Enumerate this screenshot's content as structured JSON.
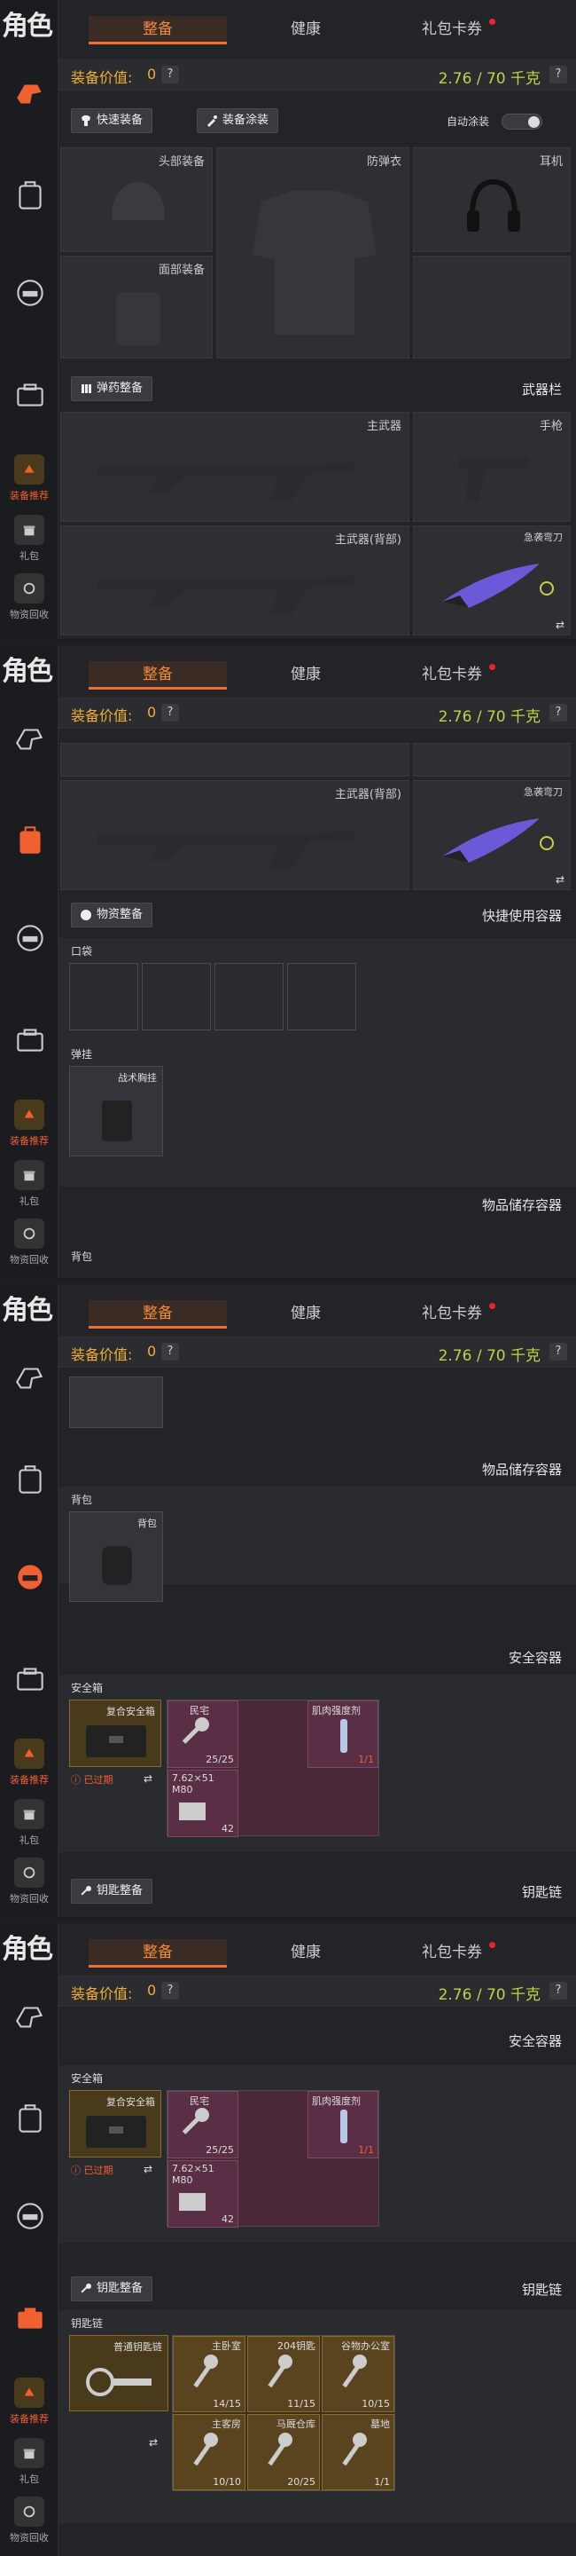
{
  "app": {
    "title": "角色"
  },
  "tabs": [
    {
      "label": "整备"
    },
    {
      "label": "健康"
    },
    {
      "label": "礼包卡券"
    }
  ],
  "sidebar": {
    "items": [
      {
        "label": "装备推荐",
        "color": "#f06030"
      },
      {
        "label": "礼包"
      },
      {
        "label": "物资回收"
      }
    ]
  },
  "header": {
    "value_label": "装备价值:",
    "value_num": "0",
    "help": "?",
    "weight": "2.76 / 70 千克"
  },
  "equip": {
    "quick_btn": "快速装备",
    "paint_btn": "装备涂装",
    "auto_paint": "自动涂装",
    "slots": {
      "head": "头部装备",
      "armor": "防弹衣",
      "ear": "耳机",
      "face": "面部装备"
    }
  },
  "weapons": {
    "btn": "弹药整备",
    "title": "武器栏",
    "main": "主武器",
    "pistol": "手枪",
    "main_back": "主武器(背部)",
    "knife": "急袭弯刀"
  },
  "supplies": {
    "btn": "物资整备",
    "title": "快捷使用容器",
    "pocket": "口袋",
    "rig_label": "弹挂",
    "rig_item": "战术胸挂"
  },
  "storage": {
    "title": "物品储存容器",
    "bag_label": "背包",
    "bag_item": "背包"
  },
  "safe": {
    "title": "安全容器",
    "label": "安全箱",
    "box_name": "复合安全箱",
    "expired": "已过期",
    "items": [
      {
        "name": "民宅",
        "count": "25/25"
      },
      {
        "name": "肌肉强度剂",
        "count": "1/1"
      },
      {
        "name": "7.62×51\nM80",
        "count": "42"
      }
    ]
  },
  "keys": {
    "btn": "钥匙整备",
    "title": "钥匙链",
    "chain_label": "钥匙链",
    "chain_name": "普通钥匙链",
    "items": [
      {
        "name": "主卧室",
        "count": "14/15"
      },
      {
        "name": "204钥匙",
        "count": "11/15"
      },
      {
        "name": "谷物办公室",
        "count": "10/15"
      },
      {
        "name": "主客房",
        "count": "10/10"
      },
      {
        "name": "马厩仓库",
        "count": "20/25"
      },
      {
        "name": "墓地",
        "count": "1/1"
      }
    ]
  }
}
